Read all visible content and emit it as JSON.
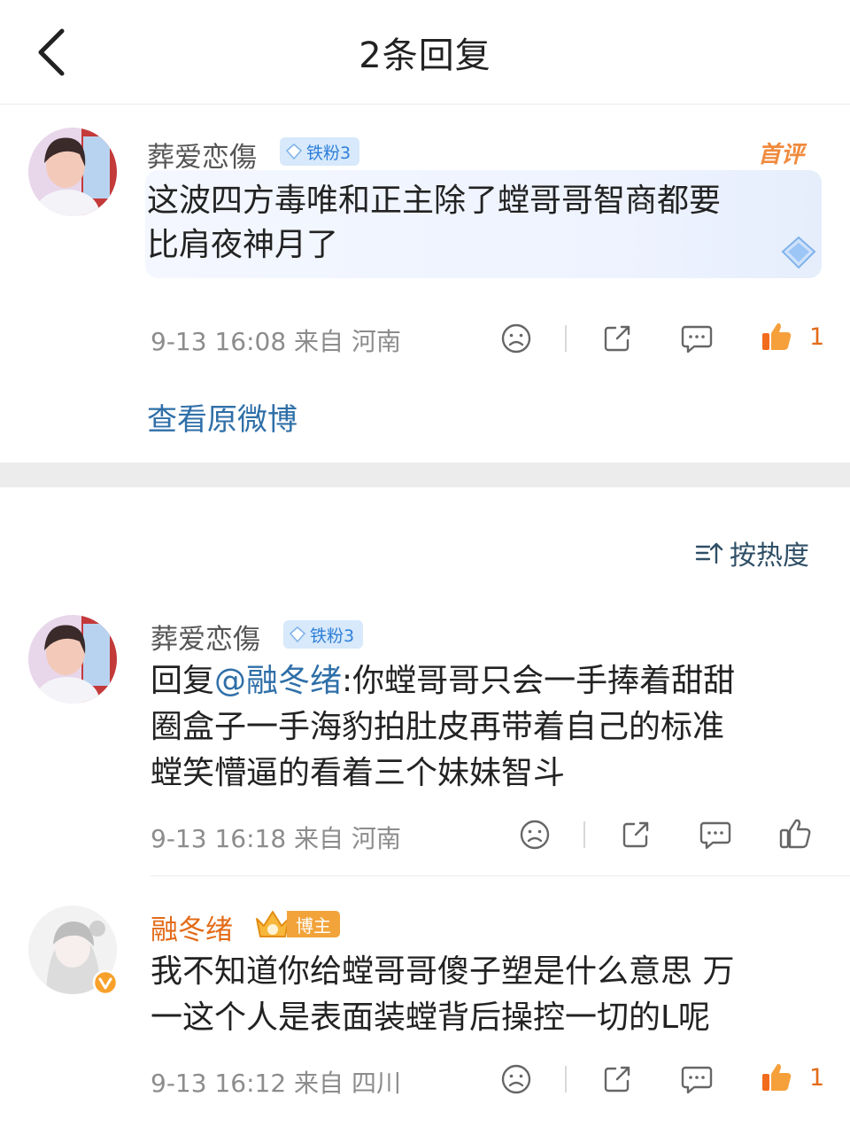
{
  "header": {
    "title": "2条回复",
    "back_icon": "chevron-left-icon"
  },
  "root": {
    "user": "葬爱恋傷",
    "badge": "铁粉3",
    "first_tag": "首评",
    "text_line1": "这波四方毒唯和正主除了螳哥哥智商都要",
    "text_line2": "比肩夜神月了",
    "time": "9-13 16:08",
    "from": "来自 河南",
    "likes": "1",
    "view_original": "查看原微博"
  },
  "sort_label": "按热度",
  "replies": [
    {
      "user": "葬爱恋傷",
      "badge": "铁粉3",
      "reply_prefix": "回复",
      "mention": "@融冬绪",
      "line1_rest": ":你螳哥哥只会一手捧着甜甜",
      "line2": "圈盒子一手海豹拍肚皮再带着自己的标准",
      "line3": "螳笑懵逼的看着三个妹妹智斗",
      "time": "9-13 16:18",
      "from": "来自 河南"
    },
    {
      "user": "融冬绪",
      "badge": "博主",
      "line1": "我不知道你给螳哥哥傻子塑是什么意思 万",
      "line2": "一这个人是表面装螳背后操控一切的L呢",
      "time": "9-13 16:12",
      "from": "来自 四川",
      "likes": "1"
    }
  ],
  "colors": {
    "link": "#2f6fa8",
    "orange": "#e36b18",
    "badge_bg": "#d7e9fb"
  }
}
